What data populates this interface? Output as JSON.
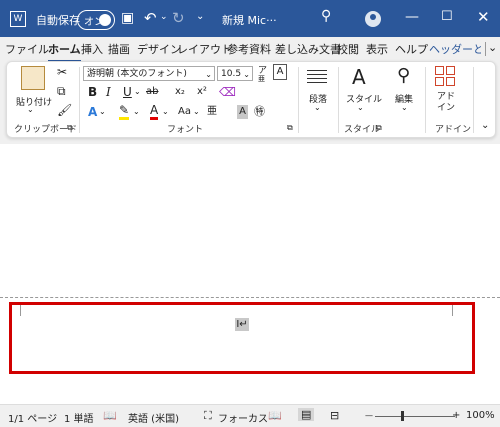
{
  "titlebar": {
    "autosave_label": "自動保存",
    "toggle_state": "オン",
    "doc_title": "新規 Mic···",
    "app_icon": "word-app-icon",
    "save_icon": "save-icon",
    "undo_icon": "undo-icon",
    "redo_icon": "redo-icon",
    "dropdown_icon": "chevron-down-icon",
    "search_icon": "search-icon",
    "account_icon": "account-avatar-icon",
    "minimize_icon": "minimize-icon",
    "maximize_icon": "maximize-icon",
    "close_icon": "close-icon"
  },
  "tabs": [
    {
      "label": "ファイル"
    },
    {
      "label": "ホーム"
    },
    {
      "label": "挿入"
    },
    {
      "label": "描画"
    },
    {
      "label": "デザイン"
    },
    {
      "label": "レイアウト"
    },
    {
      "label": "参考資料"
    },
    {
      "label": "差し込み文書"
    },
    {
      "label": "校閲"
    },
    {
      "label": "表示"
    },
    {
      "label": "ヘルプ"
    },
    {
      "label": "ヘッダーとフ"
    }
  ],
  "ribbon": {
    "clipboard": {
      "paste_label": "貼り付け",
      "group_label": "クリップボード"
    },
    "font": {
      "font_name": "游明朝 (本文のフォント)",
      "font_size": "10.5",
      "group_label": "フォント",
      "bold": "B",
      "italic": "I",
      "underline": "U",
      "strike": "ab",
      "subscript": "x₂",
      "superscript": "x²",
      "font_color": "A",
      "change_case": "Aa",
      "char_shading": "A",
      "grow_font": "ア",
      "size_unit": "亜"
    },
    "paragraph": {
      "label": "段落"
    },
    "styles": {
      "label": "スタイル",
      "group_label": "スタイル"
    },
    "editing": {
      "label": "編集"
    },
    "addin": {
      "label": "アド\nイン",
      "group_label": "アドイン"
    }
  },
  "document": {
    "cursor_text": "I↵"
  },
  "status": {
    "page": "1/1 ページ",
    "words": "1 単語",
    "language": "英語 (米国)",
    "focus": "フォーカス",
    "zoom": "100%",
    "zoom_minus": "—",
    "zoom_plus": "+"
  }
}
